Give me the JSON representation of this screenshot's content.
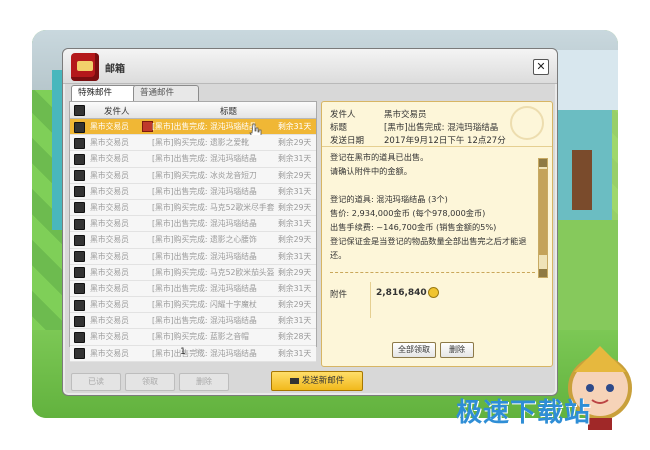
{
  "window": {
    "title": "邮箱",
    "close_glyph": "✕"
  },
  "tabs": [
    {
      "label": "特殊邮件"
    },
    {
      "label": "普通邮件"
    }
  ],
  "list": {
    "headers": {
      "sender": "发件人",
      "title": "标题"
    },
    "rows": [
      {
        "sender": "黑市交易员",
        "title": "[黑市]出售完成: 混沌玛瑙结晶",
        "remain": "剩余31天",
        "selected": true
      },
      {
        "sender": "黑市交易员",
        "title": "[黑市]购买完成: 遗影之爱靴",
        "remain": "剩余29天"
      },
      {
        "sender": "黑市交易员",
        "title": "[黑市]出售完成: 混沌玛瑙结晶",
        "remain": "剩余31天"
      },
      {
        "sender": "黑市交易员",
        "title": "[黑市]购买完成: 冰炎龙音短刀",
        "remain": "剩余29天"
      },
      {
        "sender": "黑市交易员",
        "title": "[黑市]出售完成: 混沌玛瑙结晶",
        "remain": "剩余31天"
      },
      {
        "sender": "黑市交易员",
        "title": "[黑市]购买完成: 马克52歌米尽手套",
        "remain": "剩余29天"
      },
      {
        "sender": "黑市交易员",
        "title": "[黑市]出售完成: 混沌玛瑙结晶",
        "remain": "剩余31天"
      },
      {
        "sender": "黑市交易员",
        "title": "[黑市]购买完成: 遗影之心腰饰",
        "remain": "剩余29天"
      },
      {
        "sender": "黑市交易员",
        "title": "[黑市]出售完成: 混沌玛瑙结晶",
        "remain": "剩余31天"
      },
      {
        "sender": "黑市交易员",
        "title": "[黑市]购买完成: 马克52欧米茄头盔",
        "remain": "剩余29天"
      },
      {
        "sender": "黑市交易员",
        "title": "[黑市]出售完成: 混沌玛瑙结晶",
        "remain": "剩余31天"
      },
      {
        "sender": "黑市交易员",
        "title": "[黑市]购买完成: 闪耀十字魔杖",
        "remain": "剩余29天"
      },
      {
        "sender": "黑市交易员",
        "title": "[黑市]出售完成: 混沌玛瑙结晶",
        "remain": "剩余31天"
      },
      {
        "sender": "黑市交易员",
        "title": "[黑市]购买完成: 蓝影之音帽",
        "remain": "剩余28天"
      },
      {
        "sender": "黑市交易员",
        "title": "[黑市]出售完成: 混沌玛瑙结晶",
        "remain": "剩余31天"
      }
    ],
    "page": "1",
    "next_glyph": "≫"
  },
  "buttons": {
    "read": "已读",
    "receive": "领取",
    "delete": "删除",
    "send_new": "发送新邮件"
  },
  "detail": {
    "sender_label": "发件人",
    "sender": "黑市交易员",
    "title_label": "标题",
    "title": "[黑市]出售完成: 混沌玛瑙结晶",
    "date_label": "发送日期",
    "date": "2017年9月12日下午 12点27分",
    "body": [
      "登记在黑市的道具已出售。",
      "请确认附件中的金额。",
      "",
      "登记的道具: 混沌玛瑙结晶 (3个)",
      "售价: 2,934,000金币 (每个978,000金币)",
      "出售手续费: ~146,700金币 (销售金额的5%)",
      "登记保证金是当登记的物品数量全部出售完之后才能退",
      "还。"
    ],
    "attach_label": "附件",
    "attach_amount": "2,816,840",
    "receive_all": "全部领取",
    "delete": "删除"
  },
  "watermark": "极速下载站"
}
